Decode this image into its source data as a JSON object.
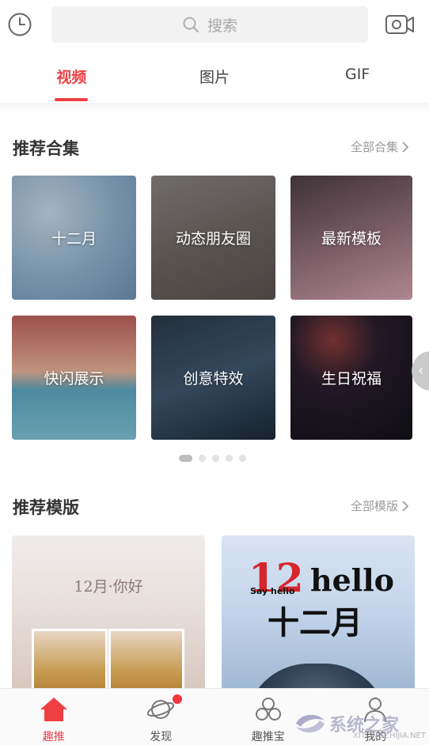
{
  "search": {
    "placeholder": "搜索"
  },
  "tabs": [
    {
      "label": "视频",
      "active": true
    },
    {
      "label": "图片",
      "active": false
    },
    {
      "label": "GIF",
      "active": false
    }
  ],
  "collections": {
    "title": "推荐合集",
    "more": "全部合集",
    "items": [
      {
        "label": "十二月"
      },
      {
        "label": "动态朋友圈"
      },
      {
        "label": "最新模板"
      },
      {
        "label": "快闪展示"
      },
      {
        "label": "创意特效"
      },
      {
        "label": "生日祝福"
      }
    ],
    "page_count": 5,
    "current_page": 1
  },
  "templates": {
    "title": "推荐模版",
    "more": "全部模版",
    "card1": {
      "caption": "12月·你好"
    },
    "card2": {
      "number": "12",
      "word": "hello",
      "small": "Say hello",
      "month": "十二月"
    }
  },
  "bottom_nav": [
    {
      "label": "趣推",
      "icon": "home-icon",
      "active": true
    },
    {
      "label": "发现",
      "icon": "planet-icon",
      "active": false,
      "badge": true
    },
    {
      "label": "趣推宝",
      "icon": "circles-icon",
      "active": false
    },
    {
      "label": "我的",
      "icon": "user-icon",
      "active": false
    }
  ],
  "watermark": {
    "text": "系统之家",
    "url": "XITONGZHIJIA.NET"
  },
  "colors": {
    "accent": "#ee3f43",
    "muted": "#9a9a9a",
    "search_bg": "#f2f2f2"
  }
}
